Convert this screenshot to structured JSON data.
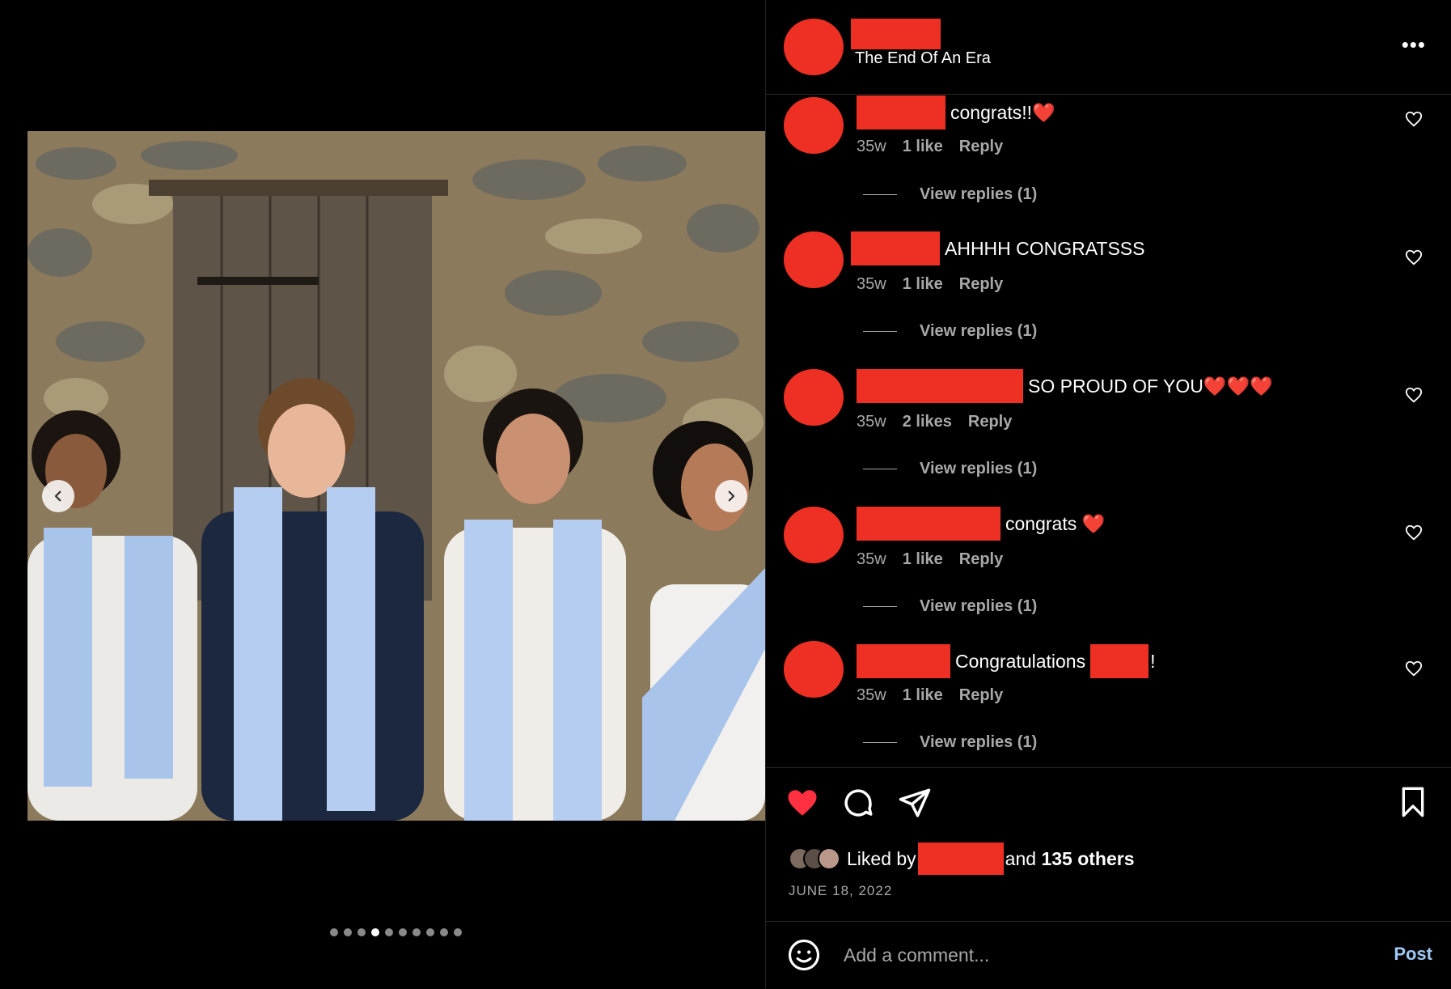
{
  "post": {
    "caption": "The End Of An Era",
    "more_label": "•••"
  },
  "photo": {
    "alt": "",
    "carousel": {
      "total": 10,
      "active_index": 3
    }
  },
  "comments": [
    {
      "text": "congrats!!❤️",
      "age": "35w",
      "likes": "1 like",
      "reply": "Reply",
      "replies": "View replies (1)"
    },
    {
      "text": "AHHHH CONGRATSSS",
      "age": "35w",
      "likes": "1 like",
      "reply": "Reply",
      "replies": "View replies (1)"
    },
    {
      "text": "SO PROUD OF YOU❤️❤️❤️",
      "age": "35w",
      "likes": "2 likes",
      "reply": "Reply",
      "replies": "View replies (1)"
    },
    {
      "text": "congrats ❤️",
      "age": "35w",
      "likes": "1 like",
      "reply": "Reply",
      "replies": "View replies (1)"
    },
    {
      "text_before": "Congratulations",
      "text_after": "!",
      "age": "35w",
      "likes": "1 like",
      "reply": "Reply",
      "replies": "View replies (1)"
    }
  ],
  "likes": {
    "prefix": "Liked by",
    "suffix_and": "and",
    "suffix_count": "135 others"
  },
  "date": "JUNE 18, 2022",
  "composer": {
    "placeholder": "Add a comment...",
    "post_label": "Post"
  },
  "colors": {
    "redaction": "#ee2f24",
    "like_red": "#ff3040",
    "post_blue": "#9ec9f3",
    "meta_gray": "#a8a8a8"
  }
}
